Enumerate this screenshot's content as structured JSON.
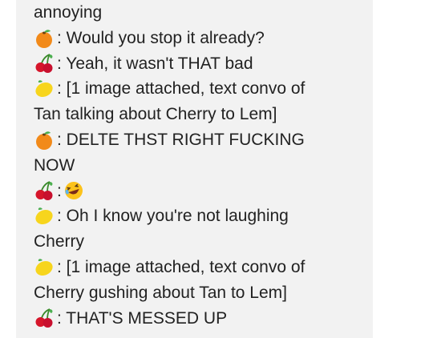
{
  "messages": [
    {
      "icon": "",
      "text": "annoying",
      "continuation": true
    },
    {
      "icon": "orange",
      "text": ": Would you stop it already?"
    },
    {
      "icon": "cherry",
      "text": ": Yeah, it wasn't THAT bad"
    },
    {
      "icon": "lemon",
      "text": ": [1 image attached, text convo of"
    },
    {
      "icon": "",
      "text": "Tan talking about Cherry to Lem]",
      "continuation": true
    },
    {
      "icon": "orange",
      "text": ": DELTE THST RIGHT FUCKING"
    },
    {
      "icon": "",
      "text": "NOW",
      "continuation": true
    },
    {
      "icon": "cherry",
      "text": ":",
      "extra_icon": "laughing-face"
    },
    {
      "icon": "lemon",
      "text": ": Oh I know you're not laughing"
    },
    {
      "icon": "",
      "text": "Cherry",
      "continuation": true
    },
    {
      "icon": "lemon",
      "text": ": [1 image attached, text convo of"
    },
    {
      "icon": "",
      "text": "Cherry gushing about Tan to Lem]",
      "continuation": true
    },
    {
      "icon": "cherry",
      "text": ": THAT'S MESSED UP"
    }
  ]
}
